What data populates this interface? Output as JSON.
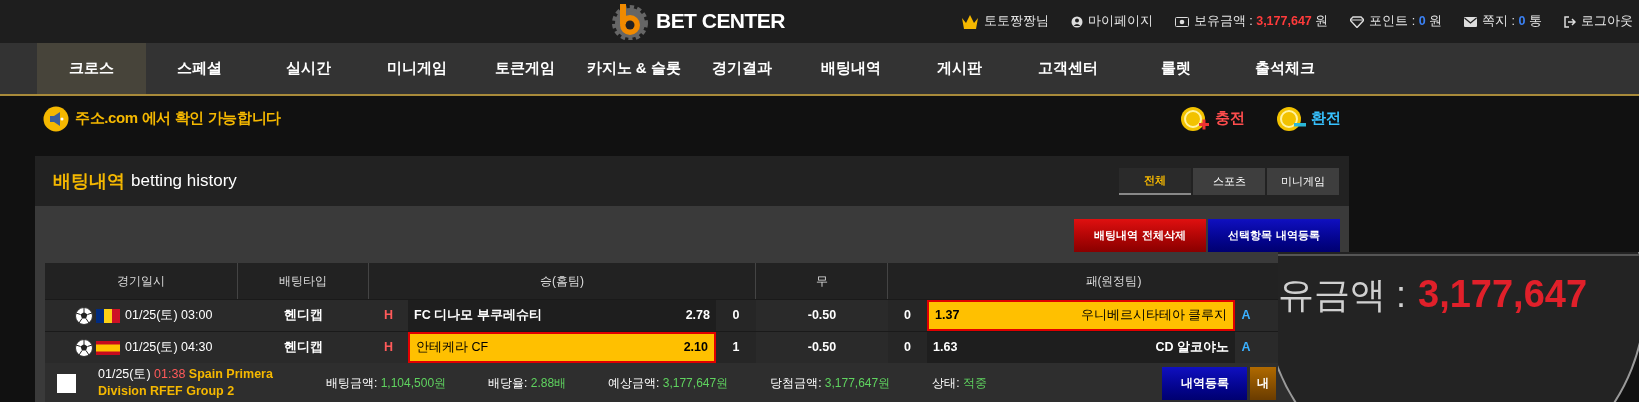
{
  "header": {
    "logo": "BET CENTER",
    "user_links": [
      {
        "kind": "user",
        "label": "토토짱짱님"
      },
      {
        "kind": "mypage",
        "label": "마이페이지"
      },
      {
        "kind": "money",
        "label": "보유금액 :",
        "value": "3,177,647",
        "unit": "원"
      },
      {
        "kind": "point",
        "label": "포인트 :",
        "value": "0",
        "unit": "원"
      },
      {
        "kind": "message",
        "label": "쪽지 :",
        "value": "0",
        "unit": "통"
      },
      {
        "kind": "logout",
        "label": "로그아웃"
      }
    ]
  },
  "nav": [
    {
      "label": "크로스",
      "selected": true
    },
    {
      "label": "스페셜",
      "selected": false
    },
    {
      "label": "실시간",
      "selected": false
    },
    {
      "label": "미니게임",
      "selected": false
    },
    {
      "label": "토큰게임",
      "selected": false
    },
    {
      "label": "카지노 & 슬롯",
      "selected": false
    },
    {
      "label": "경기결과",
      "selected": false
    },
    {
      "label": "배팅내역",
      "selected": false
    },
    {
      "label": "게시판",
      "selected": false
    },
    {
      "label": "고객센터",
      "selected": false
    },
    {
      "label": "룰렛",
      "selected": false
    },
    {
      "label": "출석체크",
      "selected": false
    }
  ],
  "notice": "주소.com 에서 확인 가능합니다",
  "wallet_buttons": [
    {
      "kind": "charge",
      "label": "충전"
    },
    {
      "kind": "exchange",
      "label": "환전"
    }
  ],
  "panel": {
    "title": "배팅내역",
    "subtitle": "betting history",
    "tabs": [
      {
        "label": "전체",
        "selected": true
      },
      {
        "label": "스포츠",
        "selected": false
      },
      {
        "label": "미니게임",
        "selected": false
      }
    ],
    "actions": [
      {
        "kind": "delete",
        "label": "배팅내역 전체삭제"
      },
      {
        "kind": "register",
        "label": "선택항목 내역등록"
      }
    ]
  },
  "table": {
    "columns": [
      "경기일시",
      "배팅타입",
      "승(홈팀)",
      "무",
      "패(원정팀)"
    ],
    "rows": [
      {
        "kind": "romania",
        "date": "01/25(토) 03:00",
        "type": "헨디캡",
        "marker": "H",
        "home": "FC 디나모 부쿠레슈티",
        "home_odds": "2.78",
        "home_selected": false,
        "home_count": "0",
        "draw": "-0.50",
        "away_count": "0",
        "away_odds": "1.37",
        "away": "우니베르시타테아 클루지",
        "away_selected": true,
        "column_6": "A"
      },
      {
        "kind": "spain",
        "date": "01/25(토) 04:30",
        "type": "헨디캡",
        "marker": "H",
        "home": "안테케라 CF",
        "home_odds": "2.10",
        "home_selected": true,
        "home_count": "1",
        "draw": "-0.50",
        "away_count": "0",
        "away_odds": "1.63",
        "away": "CD 알코야노",
        "away_selected": false,
        "column_6": "A"
      }
    ],
    "summary": {
      "checked": false,
      "date": "01/25(토)",
      "time": "01:38",
      "league": "Spain Primera Division RFEF Group 2",
      "fields": [
        {
          "label": "배팅금액:",
          "value": "1,104,500원"
        },
        {
          "label": "배당율:",
          "value": "2.88배"
        },
        {
          "label": "예상금액:",
          "value": "3,177,647원"
        },
        {
          "label": "당첨금액:",
          "value": "3,177,647원"
        },
        {
          "label": "상태:",
          "value": "적중"
        }
      ],
      "buttons": [
        {
          "kind": "register",
          "label": "내역등록"
        },
        {
          "kind": "other",
          "label": "내"
        }
      ]
    }
  },
  "magnifier": {
    "label": "유금액 :",
    "value": "3,177,647"
  }
}
